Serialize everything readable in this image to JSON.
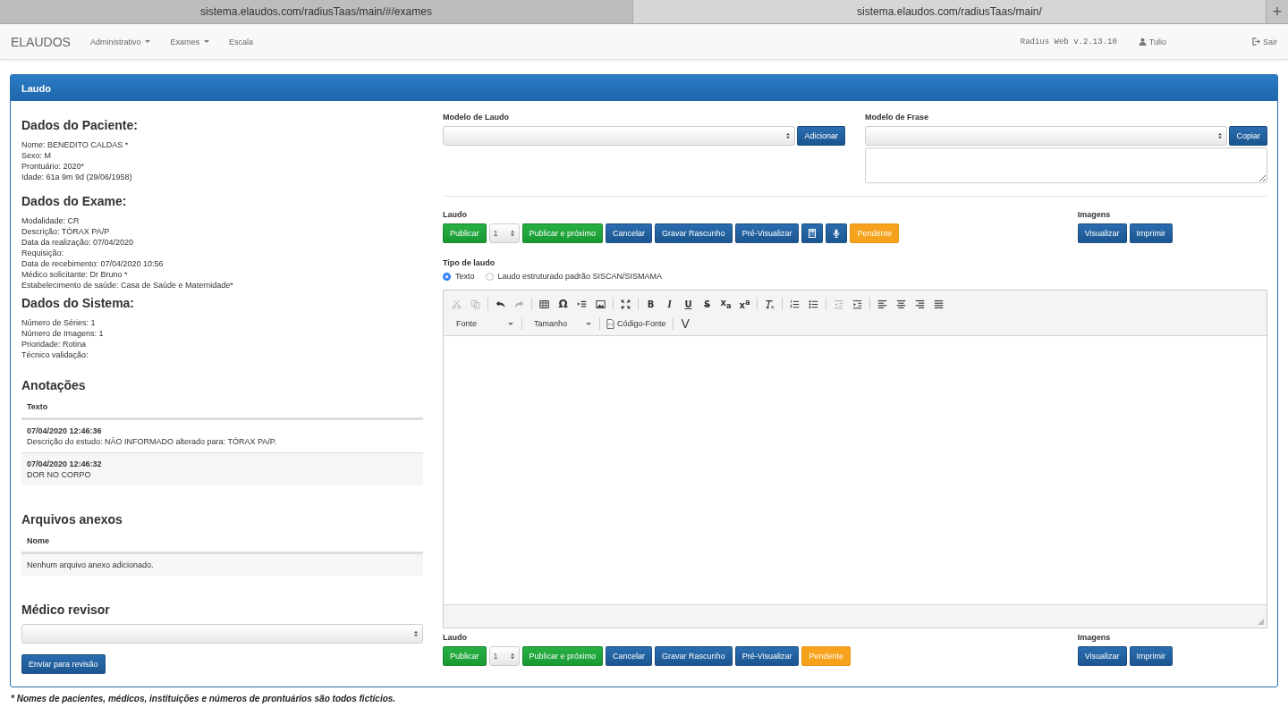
{
  "browser_tabs": [
    {
      "title": "sistema.elaudos.com/radiusTaas/main/#/exames",
      "selected": false
    },
    {
      "title": "sistema.elaudos.com/radiusTaas/main/",
      "selected": true
    }
  ],
  "new_tab": "+",
  "navbar": {
    "brand": "ELAUDOS",
    "menu": [
      {
        "label": "Administrativo",
        "dropdown": true
      },
      {
        "label": "Exames",
        "dropdown": true
      },
      {
        "label": "Escala",
        "dropdown": false
      }
    ],
    "version": "Radius Web v.2.13.10",
    "user": "Tulio",
    "logout": "Sair"
  },
  "panel": {
    "title": "Laudo"
  },
  "info_sections": [
    {
      "title": "Dados do Paciente:",
      "lines": [
        "Nome: BENEDITO CALDAS *",
        "Sexo: M",
        "Prontuário: 2020*",
        "Idade: 61a 9m 9d (29/06/1958)"
      ]
    },
    {
      "title": "Dados do Exame:",
      "lines": [
        "Modalidade: CR",
        "Descrição: TÓRAX PA/P",
        "Data da realização: 07/04/2020",
        "Requisição:",
        "Data de recebimento: 07/04/2020 10:56",
        "Médico solicitante: Dr Bruno *",
        "Estabelecimento de saúde: Casa de Saúde e Maternidade*"
      ]
    },
    {
      "title": "Dados do Sistema:",
      "lines": [
        "Número de Séries: 1",
        "Número de Imagens: 1",
        "Prioridade: Rotina",
        "Técnico validação:"
      ]
    }
  ],
  "annotations": {
    "title": "Anotações",
    "column": "Texto",
    "rows": [
      {
        "time": "07/04/2020 12:46:36",
        "text": "Descrição do estudo: NÃO INFORMADO alterado para: TÓRAX PA/P."
      },
      {
        "time": "07/04/2020 12:46:32",
        "text": "DOR NO CORPO"
      }
    ]
  },
  "attachments": {
    "title": "Arquivos anexos",
    "column": "Nome",
    "empty": "Nenhum arquivo anexo adicionado."
  },
  "reviewer": {
    "title": "Médico revisor",
    "button": "Enviar para revisão"
  },
  "report_template": {
    "label": "Modelo de Laudo",
    "button": "Adicionar"
  },
  "phrase_template": {
    "label": "Modelo de Frase",
    "button": "Copiar"
  },
  "action_bars": [
    {
      "label": "Laudo",
      "buttons": [
        {
          "kind": "success",
          "label": "Publicar"
        },
        {
          "kind": "select",
          "value": "1"
        },
        {
          "kind": "success",
          "label": "Publicar e próximo"
        },
        {
          "kind": "primary",
          "label": "Cancelar"
        },
        {
          "kind": "primary",
          "label": "Gravar Rascunho"
        },
        {
          "kind": "primary",
          "label": "Pré-Visualizar"
        },
        {
          "kind": "calculator"
        },
        {
          "kind": "microphone"
        },
        {
          "kind": "warning",
          "label": "Pendente"
        }
      ],
      "images_label": "Imagens",
      "image_buttons": [
        "Visualizar",
        "Imprimir"
      ]
    },
    {
      "label": "Laudo",
      "buttons": [
        {
          "kind": "success",
          "label": "Publicar"
        },
        {
          "kind": "select",
          "value": "1"
        },
        {
          "kind": "success",
          "label": "Publicar e próximo"
        },
        {
          "kind": "primary",
          "label": "Cancelar"
        },
        {
          "kind": "primary",
          "label": "Gravar Rascunho"
        },
        {
          "kind": "primary",
          "label": "Pré-Visualizar"
        },
        {
          "kind": "warning",
          "label": "Pendente"
        }
      ],
      "images_label": "Imagens",
      "image_buttons": [
        "Visualizar",
        "Imprimir"
      ]
    }
  ],
  "report_type": {
    "label": "Tipo de laudo",
    "options": [
      {
        "label": "Texto",
        "selected": true
      },
      {
        "label": "Laudo estruturado padrão SISCAN/SISMAMA",
        "selected": false
      }
    ]
  },
  "editor": {
    "tool_groups": [
      [
        {
          "kind": "cut",
          "disabled": true
        },
        {
          "kind": "copy",
          "disabled": true
        }
      ],
      [
        {
          "kind": "undo",
          "disabled": false
        },
        {
          "kind": "redo",
          "disabled": true
        }
      ],
      [
        {
          "kind": "table",
          "disabled": false
        },
        {
          "kind": "glyph",
          "label": "Ω",
          "disabled": false
        },
        {
          "kind": "indent-block",
          "disabled": false
        },
        {
          "kind": "image",
          "disabled": false
        }
      ],
      [
        {
          "kind": "maximize",
          "disabled": false
        }
      ],
      [
        {
          "kind": "bold",
          "label": "B",
          "disabled": false
        },
        {
          "kind": "italic",
          "label": "I",
          "disabled": false
        },
        {
          "kind": "underline",
          "label": "U",
          "disabled": false
        },
        {
          "kind": "strike",
          "label": "S",
          "disabled": false
        },
        {
          "kind": "script",
          "label": "x$_{a}$",
          "disabled": false
        },
        {
          "kind": "script",
          "label": "x$^{a}$",
          "disabled": false
        }
      ],
      [
        {
          "kind": "clear-format",
          "disabled": false
        }
      ],
      [
        {
          "kind": "numbered-list",
          "disabled": false
        },
        {
          "kind": "bulleted-list",
          "disabled": false
        }
      ],
      [
        {
          "kind": "outdent",
          "disabled": true
        },
        {
          "kind": "indent",
          "disabled": false
        }
      ],
      [
        {
          "kind": "align-left",
          "disabled": false
        },
        {
          "kind": "align-center",
          "disabled": false
        },
        {
          "kind": "align-right",
          "disabled": false
        },
        {
          "kind": "justify",
          "disabled": false
        }
      ]
    ],
    "font": "Fonte",
    "size": "Tamanho",
    "source": "Código-Fonte",
    "extra": "V"
  },
  "footnote": "* Nomes de pacientes, médicos, instituições e números de prontuários são todos fictícios."
}
